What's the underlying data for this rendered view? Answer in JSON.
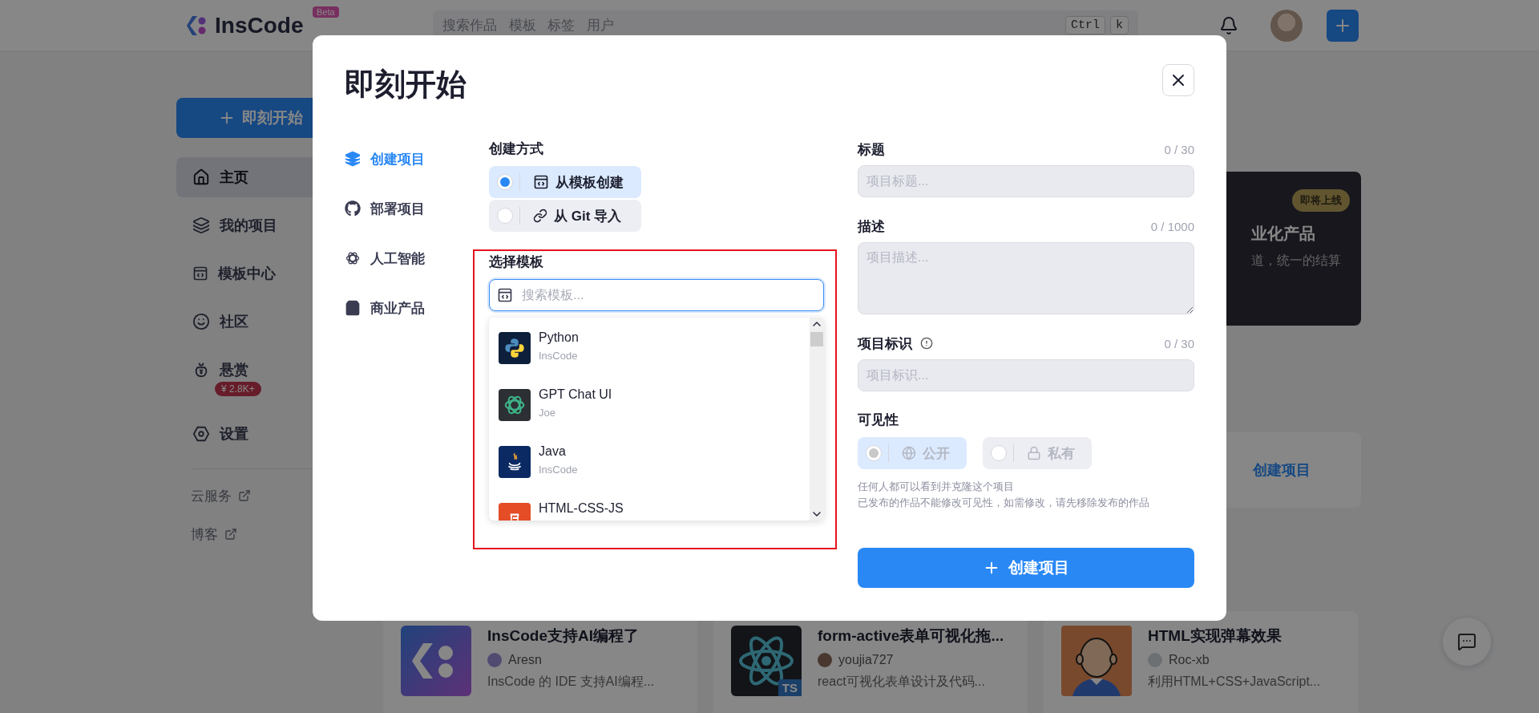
{
  "topbar": {
    "logo": "InsCode",
    "logo_badge": "Beta",
    "search_placeholder": "搜索作品 模板 标签 用户",
    "shortcut_keys": [
      "Ctrl",
      "k"
    ]
  },
  "sidebar": {
    "start_button": "即刻开始",
    "items": [
      {
        "label": "主页",
        "selected": true
      },
      {
        "label": "我的项目",
        "selected": false
      },
      {
        "label": "模板中心",
        "selected": false
      },
      {
        "label": "社区",
        "selected": false
      },
      {
        "label": "悬赏",
        "selected": false,
        "badge": "¥ 2.8K+"
      },
      {
        "label": "设置",
        "selected": false
      }
    ],
    "links": [
      "云服务",
      "博客"
    ]
  },
  "promo_card": {
    "badge": "即将上线",
    "title": "业化产品",
    "text": "道，统一的结算"
  },
  "action_card": {
    "label": "创建项目"
  },
  "project_cards": [
    {
      "kind": "logo",
      "title": "InsCode支持AI编程了",
      "author": "Aresn",
      "description": "InsCode 的 IDE 支持AI编程..."
    },
    {
      "kind": "atom",
      "badge": "TS",
      "title": "form-active表单可视化拖...",
      "author": "youjia727",
      "description": "react可视化表单设计及代码..."
    },
    {
      "kind": "figure",
      "title": "HTML实现弹幕效果",
      "author": "Roc-xb",
      "description": "利用HTML+CSS+JavaScript..."
    }
  ],
  "dialog": {
    "title": "即刻开始",
    "nav": [
      {
        "label": "创建项目",
        "selected": true
      },
      {
        "label": "部署项目",
        "selected": false
      },
      {
        "label": "人工智能",
        "selected": false
      },
      {
        "label": "商业产品",
        "selected": false
      }
    ],
    "method": {
      "label": "创建方式",
      "options": [
        {
          "label": "从模板创建",
          "selected": true
        },
        {
          "label": "从 Git 导入",
          "selected": false
        }
      ]
    },
    "template": {
      "label": "选择模板",
      "placeholder": "搜索模板...",
      "items": [
        {
          "kind": "snake",
          "name": "Python",
          "author": "InsCode"
        },
        {
          "kind": "knot",
          "name": "GPT Chat UI",
          "author": "Joe"
        },
        {
          "kind": "coffee",
          "name": "Java",
          "author": "InsCode"
        },
        {
          "kind": "shield",
          "name": "HTML-CSS-JS"
        }
      ]
    },
    "fields": [
      {
        "kind": "input",
        "label": "标题",
        "counter": "0 / 30",
        "placeholder": "项目标题..."
      },
      {
        "kind": "textarea",
        "label": "描述",
        "counter": "0 / 1000",
        "placeholder": "项目描述..."
      },
      {
        "kind": "input",
        "label": "项目标识",
        "info": true,
        "counter": "0 / 30",
        "placeholder": "项目标识..."
      }
    ],
    "visibility": {
      "label": "可见性",
      "disabled": true,
      "options": [
        {
          "label": "公开",
          "selected": true
        },
        {
          "label": "私有",
          "selected": false
        }
      ],
      "hints": [
        "任何人都可以看到并克隆这个项目",
        "已发布的作品不能修改可见性，如需修改，请先移除发布的作品"
      ]
    },
    "submit": "创建项目"
  }
}
